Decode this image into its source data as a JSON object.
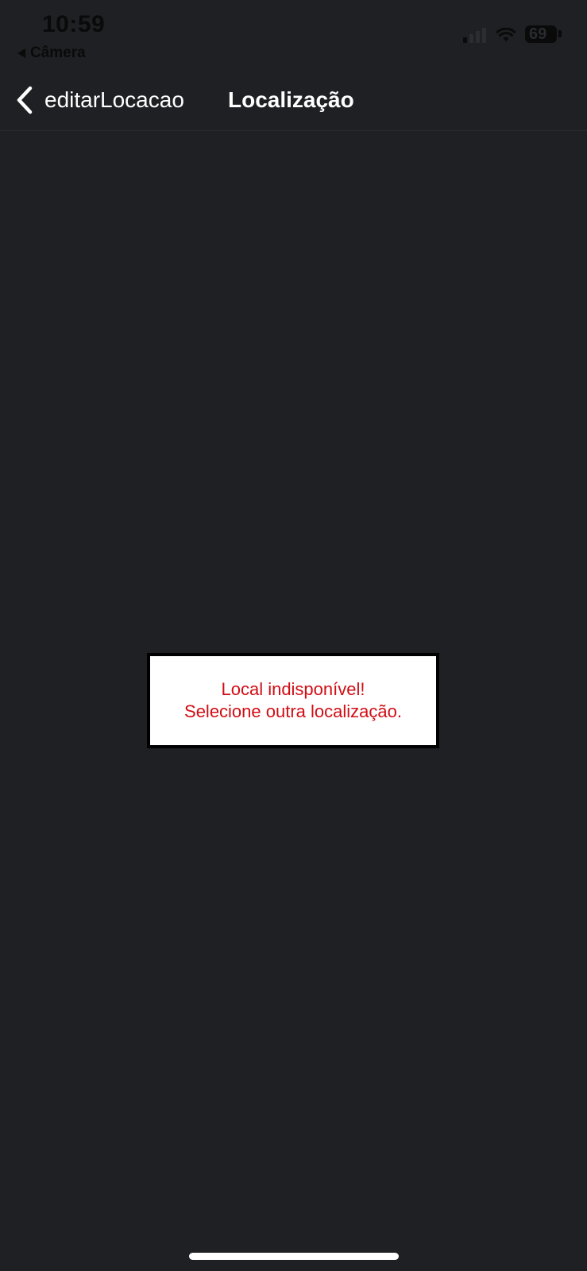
{
  "status_bar": {
    "time": "10:59",
    "back_app_label": "Câmera",
    "battery_level": "69"
  },
  "nav": {
    "back_label": "editarLocacao",
    "title": "Localização"
  },
  "alert": {
    "line1": "Local indisponível!",
    "line2": "Selecione outra localização."
  },
  "colors": {
    "background": "#1f2024",
    "alert_text": "#d10d14",
    "alert_background": "#ffffff",
    "alert_border": "#000000"
  }
}
